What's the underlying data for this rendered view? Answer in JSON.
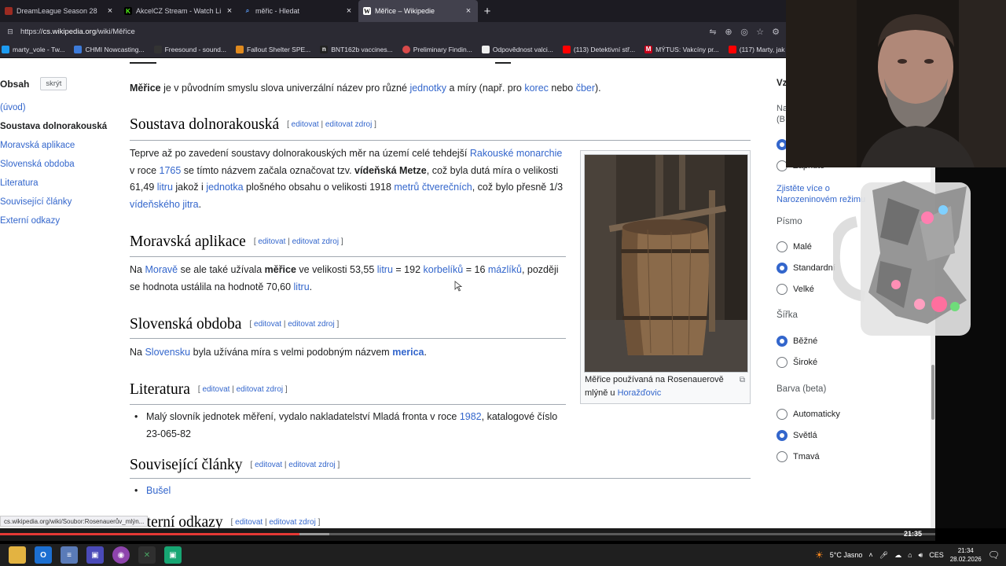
{
  "tabs": [
    {
      "title": "DreamLeague Season 28",
      "favicon": "dota-icon",
      "color": "#9c2b22",
      "active": false
    },
    {
      "title": "AkcelCZ Stream - Watch Live on K",
      "favicon": "kick-icon",
      "color": "#53fc18",
      "active": false
    },
    {
      "title": "měřic - Hledat",
      "favicon": "search-icon",
      "color": "#5a9cf8",
      "active": false
    },
    {
      "title": "Měřice – Wikipedie",
      "favicon": "wikipedia-icon",
      "color": "#ffffff",
      "active": true
    }
  ],
  "url": {
    "scheme": "https://",
    "domain": "cs.wikipedia.org",
    "path": "/wiki/Měřice"
  },
  "bookmarks": [
    {
      "label": "marty_vole - Tw...",
      "color": "#1d9bf0"
    },
    {
      "label": "CHMI Nowcasting...",
      "color": "#3d7bd9"
    },
    {
      "label": "Freesound - sound...",
      "color": "#333333"
    },
    {
      "label": "Fallout Shelter SPE...",
      "color": "#e08a1e"
    },
    {
      "label": "BNT162b vaccines...",
      "color": "#222222"
    },
    {
      "label": "Preliminary Findin...",
      "color": "#d84a4a"
    },
    {
      "label": "Odpovědnost valci...",
      "color": "#eeeeee"
    },
    {
      "label": "(113) Detektivní stř...",
      "color": "#ff0000"
    },
    {
      "label": "MÝTUS: Vakcíny pr...",
      "color": "#c4001a"
    },
    {
      "label": "(117) Marty, jak m...",
      "color": "#ff0000"
    }
  ],
  "toc": {
    "title": "Obsah",
    "hide": "skrýt",
    "items": [
      "(úvod)",
      "Soustava dolnorakouská",
      "Moravská aplikace",
      "Slovenská obdoba",
      "Literatura",
      "Související články",
      "Externí odkazy"
    ]
  },
  "edit_links": {
    "edit": "editovat",
    "edit_source": "editovat zdroj"
  },
  "intro": {
    "t1": "Měřice",
    "t2": " je v původním smyslu slova univerzální název pro různé ",
    "l1": "jednotky",
    "t3": " a míry (např. pro ",
    "l2": "korec",
    "t4": " nebo ",
    "l3": "čber",
    "t5": ")."
  },
  "sec1": {
    "title": "Soustava dolnorakouská",
    "a1": "Teprve až po zavedení soustavy dolnorakouských měr na území celé tehdejší ",
    "l1": "Rakouské monarchie",
    "a2": " v roce ",
    "l2": "1765",
    "a3": " se tímto názvem začala označovat tzv. ",
    "b1": "vídeňská Metze",
    "a4": ", což byla dutá míra o velikosti 61,49 ",
    "l3": "litru",
    "a5": " jakož i ",
    "l4": "jednotka",
    "a6": " plošného obsahu o velikosti 1918 ",
    "l5": "metrů čtverečních",
    "a7": ", což bylo přesně 1/3 ",
    "l6": "vídeňského jitra",
    "a8": "."
  },
  "sec2": {
    "title": "Moravská aplikace",
    "a1": "Na ",
    "l1": "Moravě",
    "a2": " se ale také užívala ",
    "b1": "měřice",
    "a3": " ve velikosti 53,55 ",
    "l2": "litru",
    "a4": " = 192 ",
    "l3": "korbelíků",
    "a5": " = 16 ",
    "l4": "mázlíků",
    "a6": ", později se hodnota ustálila na hodnotě 70,60 ",
    "l5": "litru",
    "a7": "."
  },
  "sec3": {
    "title": "Slovenská obdoba",
    "a1": "Na ",
    "l1": "Slovensku",
    "a2": " byla užívána míra s velmi podobným názvem ",
    "l2": "merica",
    "a3": "."
  },
  "sec4": {
    "title": "Literatura",
    "a1": "Malý slovník jednotek měření, vydalo nakladatelství Mladá fronta v roce ",
    "l1": "1982",
    "a2": ", katalogové číslo 23-065-82"
  },
  "sec5": {
    "title": "Související články",
    "item": "Bušel"
  },
  "sec6": {
    "title": "Externí odkazy"
  },
  "thumb_caption": {
    "a1": "Měřice používaná na Rosenauerově mlýně u ",
    "l1": "Horažďovic"
  },
  "appearance": {
    "heading_partial": "Vz",
    "text_partial": "Na",
    "text_partial2": "(B",
    "option_partial": "Zapnuto",
    "learn_more": "Zjistěte více o Narozeninovém režimu",
    "font_label": "Písmo",
    "font_options": [
      "Malé",
      "Standardní",
      "Velké"
    ],
    "font_selected": 1,
    "width_label": "Šířka",
    "width_options": [
      "Běžné",
      "Široké"
    ],
    "width_selected": 0,
    "color_label": "Barva (beta)",
    "color_options": [
      "Automaticky",
      "Světlá",
      "Tmavá"
    ],
    "color_selected": 1
  },
  "status_url": "cs.wikipedia.org/wiki/Soubor:Rosenauerův_mlýn...",
  "video": {
    "time": "21:35",
    "progress": 0.32
  },
  "taskbar": {
    "weather": "5°C  Jasno",
    "lang": "CES",
    "time": "21:34",
    "date": "28.02.2026"
  }
}
